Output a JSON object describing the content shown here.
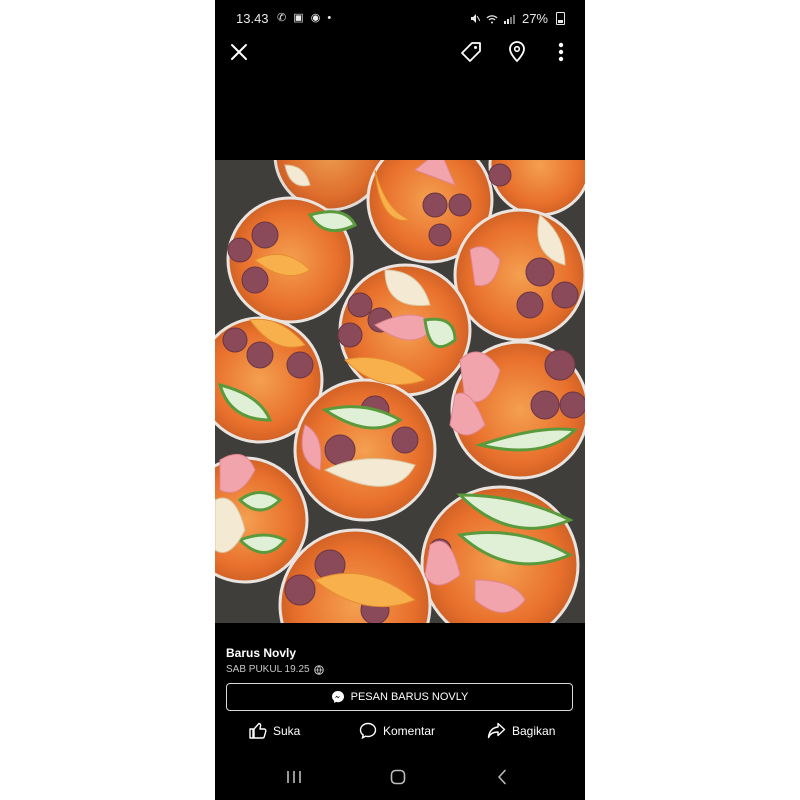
{
  "status_bar": {
    "time": "13.43",
    "left_icons": [
      "whatsapp-icon",
      "gallery-icon",
      "chrome-icon",
      "dot-icon"
    ],
    "right_icons": [
      "mute-icon",
      "wifi-icon",
      "signal-icon",
      "battery-icon"
    ],
    "battery": "27%"
  },
  "top_bar": {
    "icons": [
      "close-icon",
      "tag-icon",
      "location-pin-icon",
      "more-vertical-icon"
    ]
  },
  "post": {
    "author": "Barus Novly",
    "timestamp": "SAB PUKUL 19.25",
    "privacy_icon": "globe-icon"
  },
  "message_button": {
    "icon": "messenger-icon",
    "label": "PESAN BARUS NOVLY"
  },
  "actions": {
    "like": "Suka",
    "comment": "Komentar",
    "share": "Bagikan"
  },
  "nav_bar": {
    "icons": [
      "recent-apps-icon",
      "home-icon",
      "back-icon"
    ]
  },
  "colors": {
    "background": "#000000",
    "text": "#ffffff",
    "secondary_text": "#c7c7c7",
    "page_background": "#ffffff"
  }
}
